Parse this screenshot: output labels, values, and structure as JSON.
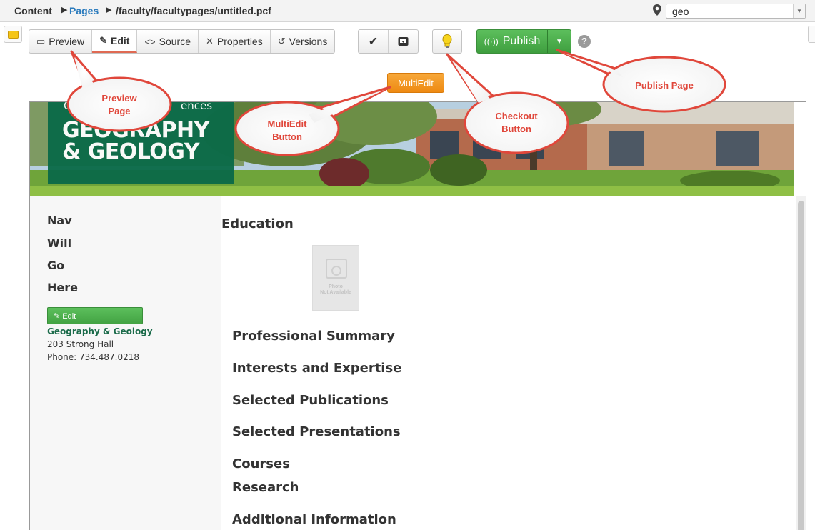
{
  "breadcrumb": {
    "root": "Content",
    "section": "Pages",
    "path": "/faculty/facultypages/untitled.pcf"
  },
  "site_select": {
    "value": "geo"
  },
  "toolbar": {
    "preview": "Preview",
    "edit": "Edit",
    "source": "Source",
    "properties": "Properties",
    "versions": "Versions",
    "publish": "Publish",
    "help": "?",
    "multiedit": "MultiEdit"
  },
  "callouts": {
    "preview_line1": "Preview",
    "preview_line2": "Page",
    "multiedit_line1": "MultiEdit",
    "multiedit_line2": "Button",
    "checkout_line1": "Checkout",
    "checkout_line2": "Button",
    "publish": "Publish Page"
  },
  "banner": {
    "college_partial": "C",
    "college_partial_right": "ences",
    "title_line1": "GEOGRAPHY",
    "title_line2": "& GEOLOGY"
  },
  "sidebar": {
    "nav": [
      "Nav",
      "Will",
      "Go",
      "Here"
    ],
    "edit_label": "Edit",
    "dept": "Geography & Geology",
    "address": "203 Strong Hall",
    "phone": "Phone: 734.487.0218"
  },
  "content": {
    "education": "Education",
    "photo_text_line1": "Photo",
    "photo_text_line2": "Not Available",
    "sections": [
      "Professional Summary",
      "Interests and Expertise",
      "Selected Publications",
      "Selected Presentations",
      "Courses",
      "Research",
      "Additional Information"
    ]
  },
  "colors": {
    "brand_green": "#006747",
    "publish_green": "#4cae4c",
    "multiedit_orange": "#f0901a",
    "callout_red": "#e0473b",
    "link_blue": "#2b7bbd"
  }
}
